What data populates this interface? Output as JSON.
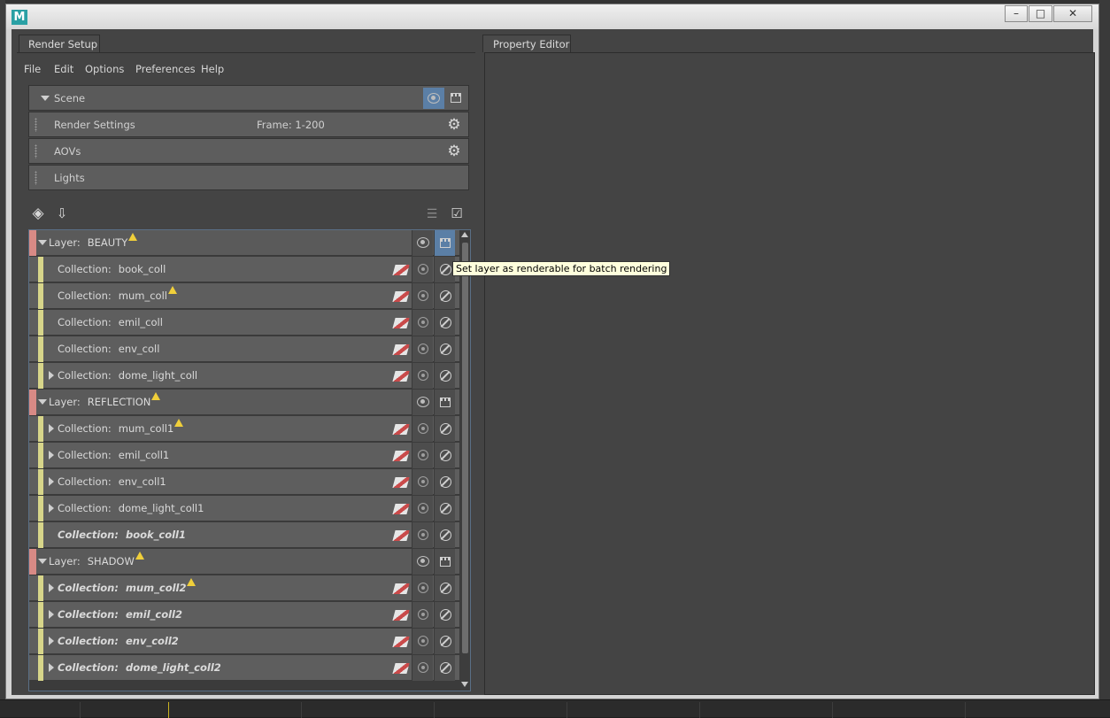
{
  "window": {
    "app_logo": "M",
    "controls": {
      "minimize": "–",
      "maximize": "□",
      "close": "✕"
    }
  },
  "render_setup": {
    "tab_label": "Render Setup",
    "menu": [
      "File",
      "Edit",
      "Options",
      "Preferences",
      "Help"
    ],
    "scene": {
      "label": "Scene",
      "rows": [
        {
          "label": "Render Settings",
          "detail": "Frame: 1-200",
          "icon": "gear-icon"
        },
        {
          "label": "AOVs",
          "detail": "",
          "icon": "gear-icon"
        },
        {
          "label": "Lights",
          "detail": "",
          "icon": ""
        }
      ]
    },
    "toolbar": {
      "create_layer_icon": "add-layer-icon",
      "import_icon": "import-icon",
      "solo_icon": "solo-icon",
      "accept_icon": "accept-icon"
    },
    "tree": [
      {
        "kind": "layer",
        "prefix": "Layer:",
        "name": "BEAUTY",
        "warning": true,
        "expanded": true,
        "renderable_selected": true
      },
      {
        "kind": "collection",
        "prefix": "Collection:",
        "name": "book_coll",
        "warning": false,
        "expandable": false,
        "italic": false
      },
      {
        "kind": "collection",
        "prefix": "Collection:",
        "name": "mum_coll",
        "warning": true,
        "expandable": false,
        "italic": false
      },
      {
        "kind": "collection",
        "prefix": "Collection:",
        "name": "emil_coll",
        "warning": false,
        "expandable": false,
        "italic": false
      },
      {
        "kind": "collection",
        "prefix": "Collection:",
        "name": "env_coll",
        "warning": false,
        "expandable": false,
        "italic": false
      },
      {
        "kind": "collection",
        "prefix": "Collection:",
        "name": "dome_light_coll",
        "warning": false,
        "expandable": true,
        "italic": false
      },
      {
        "kind": "layer",
        "prefix": "Layer:",
        "name": "REFLECTION",
        "warning": true,
        "expanded": true,
        "renderable_selected": false
      },
      {
        "kind": "collection",
        "prefix": "Collection:",
        "name": "mum_coll1",
        "warning": true,
        "expandable": true,
        "italic": false
      },
      {
        "kind": "collection",
        "prefix": "Collection:",
        "name": "emil_coll1",
        "warning": false,
        "expandable": true,
        "italic": false
      },
      {
        "kind": "collection",
        "prefix": "Collection:",
        "name": "env_coll1",
        "warning": false,
        "expandable": true,
        "italic": false
      },
      {
        "kind": "collection",
        "prefix": "Collection:",
        "name": "dome_light_coll1",
        "warning": false,
        "expandable": true,
        "italic": false
      },
      {
        "kind": "collection",
        "prefix": "Collection:",
        "name": "book_coll1",
        "warning": false,
        "expandable": false,
        "italic": true
      },
      {
        "kind": "layer",
        "prefix": "Layer:",
        "name": "SHADOW",
        "warning": true,
        "expanded": true,
        "renderable_selected": false
      },
      {
        "kind": "collection",
        "prefix": "Collection:",
        "name": "mum_coll2",
        "warning": true,
        "expandable": true,
        "italic": true
      },
      {
        "kind": "collection",
        "prefix": "Collection:",
        "name": "emil_coll2",
        "warning": false,
        "expandable": true,
        "italic": true
      },
      {
        "kind": "collection",
        "prefix": "Collection:",
        "name": "env_coll2",
        "warning": false,
        "expandable": true,
        "italic": true
      },
      {
        "kind": "collection",
        "prefix": "Collection:",
        "name": "dome_light_coll2",
        "warning": false,
        "expandable": true,
        "italic": true
      }
    ],
    "tooltip": "Set layer as renderable for batch rendering"
  },
  "property_editor": {
    "tab_label": "Property Editor"
  },
  "colors": {
    "layer_strip": "#d88a85",
    "collection_strip": "#d7d58a",
    "selected_button": "#5b7fa6",
    "warning": "#f0cf3a"
  }
}
